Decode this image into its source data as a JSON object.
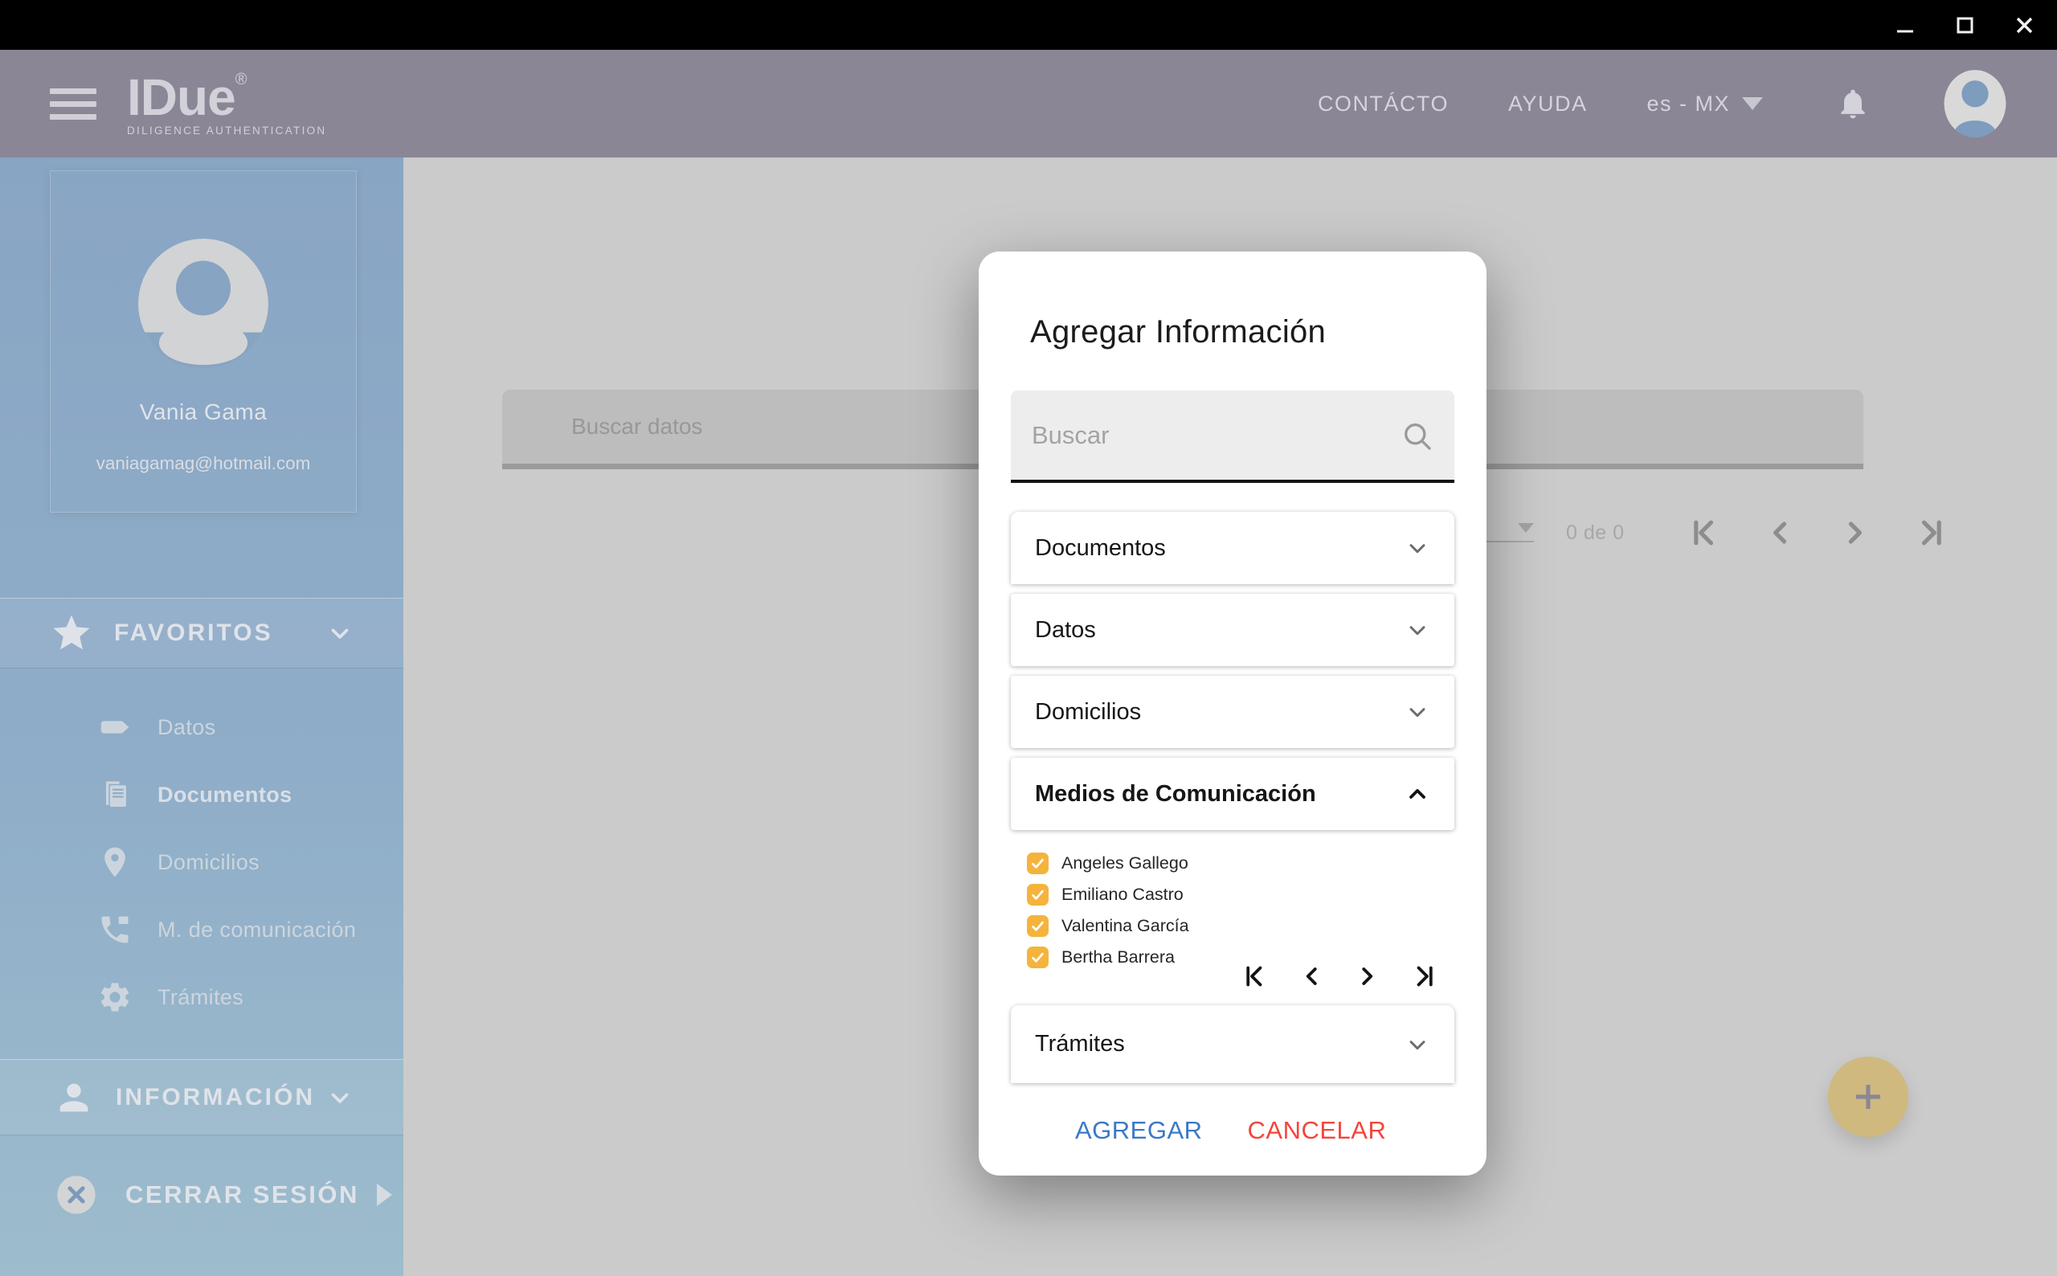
{
  "titlebar": {
    "controls": [
      "minimize",
      "maximize",
      "close"
    ]
  },
  "header": {
    "logo": {
      "text": "IDue",
      "mark": "®",
      "subtitle": "DILIGENCE AUTHENTICATION"
    },
    "nav": {
      "contacto": "CONTÁCTO",
      "ayuda": "AYUDA"
    },
    "language": "es - MX"
  },
  "sidebar": {
    "profile": {
      "name": "Vania Gama",
      "email": "vaniagamag@hotmail.com"
    },
    "favoritos": {
      "label": "FAVORITOS",
      "items": [
        {
          "label": "Datos",
          "icon": "tag-icon",
          "active": false
        },
        {
          "label": "Documentos",
          "icon": "documents-icon",
          "active": true
        },
        {
          "label": "Domicilios",
          "icon": "location-pin-icon",
          "active": false
        },
        {
          "label": "M. de comunicación",
          "icon": "phone-icon",
          "active": false
        },
        {
          "label": "Trámites",
          "icon": "gear-icon",
          "active": false
        }
      ]
    },
    "informacion": {
      "label": "INFORMACIÓN"
    },
    "cerrar_sesion": {
      "label": "CERRAR SESIÓN"
    }
  },
  "content": {
    "search_placeholder": "Buscar datos",
    "pagination": {
      "range": "0 de 0"
    }
  },
  "modal": {
    "title": "Agregar Información",
    "search_placeholder": "Buscar",
    "accordions": [
      {
        "label": "Documentos",
        "expanded": false
      },
      {
        "label": "Datos",
        "expanded": false
      },
      {
        "label": "Domicilios",
        "expanded": false
      },
      {
        "label": "Medios de Comunicación",
        "expanded": true
      },
      {
        "label": "Trámites",
        "expanded": false
      }
    ],
    "people": [
      {
        "label": "Angeles Gallego",
        "checked": true
      },
      {
        "label": "Emiliano Castro",
        "checked": true
      },
      {
        "label": "Valentina García",
        "checked": true
      },
      {
        "label": "Bertha Barrera",
        "checked": true
      }
    ],
    "actions": {
      "agregar": "AGREGAR",
      "cancelar": "CANCELAR"
    }
  },
  "colors": {
    "header": "#8a8695",
    "sidebar_top": "#89a5c4",
    "sidebar_bottom": "#9dbccd",
    "content_bg": "#cbcbcb",
    "checkbox_orange": "#f4b43c",
    "agregar_blue": "#3b79c6",
    "cancelar_red": "#f2463c",
    "fab_gold": "#cfb97e"
  }
}
